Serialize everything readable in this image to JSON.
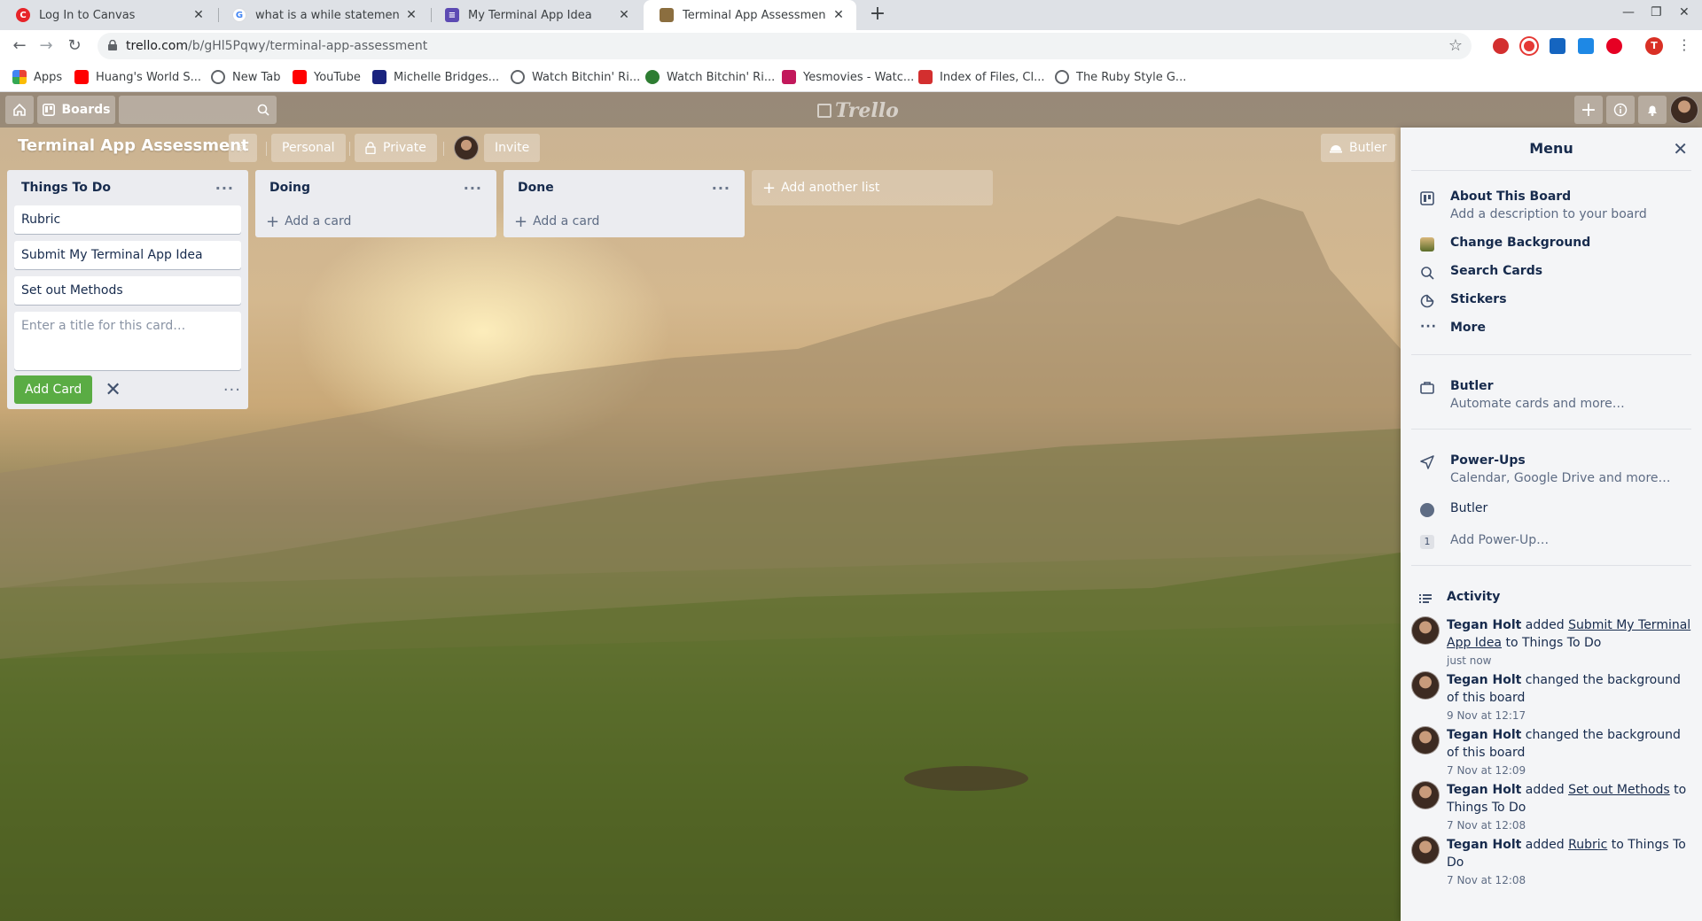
{
  "browser": {
    "tabs": [
      {
        "title": "Log In to Canvas",
        "icon": "canvas-icon",
        "color": "#e72429"
      },
      {
        "title": "what is a while statement in ru",
        "icon": "google-icon",
        "color": "#4285f4"
      },
      {
        "title": "My Terminal App Idea",
        "icon": "docs-icon",
        "color": "#5c4ab3"
      },
      {
        "title": "Terminal App Assessment | Tr",
        "icon": "trello-tab-icon",
        "color": "#8b6e3f"
      }
    ],
    "url_host": "trello.com",
    "url_path": "/b/gHl5Pqwy/terminal-app-assessment",
    "profile_initial": "T",
    "bookmarks": [
      {
        "label": "Apps",
        "icon": "apps-grid-icon",
        "color": "#ea4335"
      },
      {
        "label": "Huang's World S...",
        "icon": "youtube-icon",
        "color": "#ff0000"
      },
      {
        "label": "New Tab",
        "icon": "globe-icon",
        "color": "#5f6368"
      },
      {
        "label": "YouTube",
        "icon": "youtube-icon",
        "color": "#ff0000"
      },
      {
        "label": "Michelle Bridges...",
        "icon": "calendar-icon",
        "color": "#1a237e"
      },
      {
        "label": "Watch Bitchin' Ri...",
        "icon": "globe-icon",
        "color": "#5f6368"
      },
      {
        "label": "Watch Bitchin' Ri...",
        "icon": "dollar-icon",
        "color": "#2e7d32"
      },
      {
        "label": "Yesmovies - Watc...",
        "icon": "yesmovies-icon",
        "color": "#c2185b"
      },
      {
        "label": "Index of Files, Cl...",
        "icon": "house-icon",
        "color": "#d32f2f"
      },
      {
        "label": "The Ruby Style G...",
        "icon": "globe-icon",
        "color": "#5f6368"
      }
    ]
  },
  "header": {
    "boards_label": "Boards",
    "logo_text": "Trello"
  },
  "board": {
    "title": "Terminal App Assessment",
    "team_label": "Personal",
    "visibility_label": "Private",
    "invite_label": "Invite",
    "butler_label": "Butler",
    "add_list_label": "Add another list",
    "lists": [
      {
        "name": "Things To Do",
        "cards": [
          "Rubric",
          "Submit My Terminal App Idea",
          "Set out Methods"
        ],
        "composer_placeholder": "Enter a title for this card…",
        "add_card_button": "Add Card"
      },
      {
        "name": "Doing",
        "add_card_label": "Add a card"
      },
      {
        "name": "Done",
        "add_card_label": "Add a card"
      }
    ]
  },
  "menu": {
    "title": "Menu",
    "items": [
      {
        "title": "About This Board",
        "subtitle": "Add a description to your board",
        "icon": "board-icon"
      },
      {
        "title": "Change Background",
        "icon": "background-thumbnail-icon"
      },
      {
        "title": "Search Cards",
        "icon": "search-icon"
      },
      {
        "title": "Stickers",
        "icon": "sticker-icon"
      },
      {
        "title": "More",
        "icon": "ellipsis-icon"
      }
    ],
    "butler": {
      "title": "Butler",
      "subtitle": "Automate cards and more…"
    },
    "powerups": {
      "title": "Power-Ups",
      "subtitle": "Calendar, Google Drive and more…",
      "butler_label": "Butler",
      "add_count": "1",
      "add_label": "Add Power-Up…"
    },
    "activity_title": "Activity",
    "activity": [
      {
        "user": "Tegan Holt",
        "pre": "added",
        "link": "Submit My Terminal App Idea",
        "post": "to Things To Do",
        "time": "just now"
      },
      {
        "user": "Tegan Holt",
        "pre": "changed the background of this board",
        "link": "",
        "post": "",
        "time": "9 Nov at 12:17"
      },
      {
        "user": "Tegan Holt",
        "pre": "changed the background of this board",
        "link": "",
        "post": "",
        "time": "7 Nov at 12:09"
      },
      {
        "user": "Tegan Holt",
        "pre": "added",
        "link": "Set out Methods",
        "post": "to Things To Do",
        "time": "7 Nov at 12:08"
      },
      {
        "user": "Tegan Holt",
        "pre": "added",
        "link": "Rubric",
        "post": "to Things To Do",
        "time": "7 Nov at 12:08"
      }
    ]
  }
}
